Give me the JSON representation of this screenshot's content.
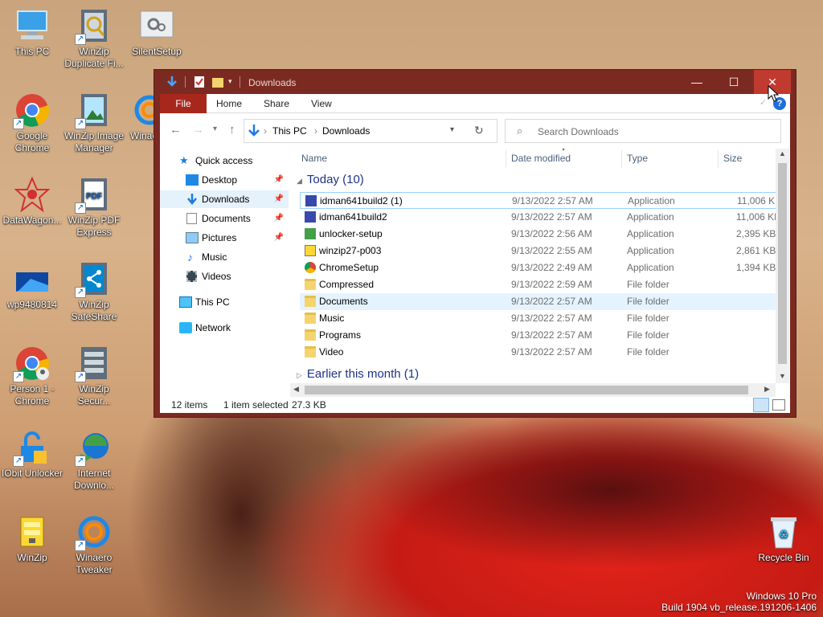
{
  "desktop": {
    "icons": [
      {
        "label": "This PC"
      },
      {
        "label": "WinZip Duplicate Fi..."
      },
      {
        "label": "SilentSetup"
      },
      {
        "label": "Google Chrome"
      },
      {
        "label": "WinZip Image Manager"
      },
      {
        "label": "Winae"
      },
      {
        "label": "DataWagon..."
      },
      {
        "label": "WinZip PDF Express"
      },
      {
        "label": "wp9480814"
      },
      {
        "label": "WinZip SafeShare"
      },
      {
        "label": "Person 1 - Chrome"
      },
      {
        "label": "WinZip Secur..."
      },
      {
        "label": "IObit Unlocker"
      },
      {
        "label": "Internet Downlo..."
      },
      {
        "label": "WinZip"
      },
      {
        "label": "Winaero Tweaker"
      },
      {
        "label": "Recycle Bin"
      }
    ],
    "watermark_line1": "Windows 10 Pro",
    "watermark_line2": "Build 1904 vb_release.191206-1406"
  },
  "window": {
    "title": "Downloads",
    "minimize_glyph": "—",
    "maximize_glyph": "☐",
    "close_glyph": "✕",
    "ribbon_tabs": [
      "File",
      "Home",
      "Share",
      "View"
    ],
    "help_glyph": "?",
    "address": {
      "crumb1": "This PC",
      "separator": "›",
      "crumb2": "Downloads"
    },
    "search_placeholder": "Search Downloads",
    "nav": {
      "quick_access": "Quick access",
      "desktop": "Desktop",
      "downloads": "Downloads",
      "documents": "Documents",
      "pictures": "Pictures",
      "music": "Music",
      "videos": "Videos",
      "this_pc": "This PC",
      "network": "Network"
    },
    "columns": {
      "name": "Name",
      "date": "Date modified",
      "type": "Type",
      "size": "Size"
    },
    "group_today": "Today (10)",
    "group_earlier": "Earlier this month (1)",
    "files": [
      {
        "name": "idman641build2 (1)",
        "date": "9/13/2022 2:57 AM",
        "type": "Application",
        "size": "11,006 KB"
      },
      {
        "name": "idman641build2",
        "date": "9/13/2022 2:57 AM",
        "type": "Application",
        "size": "11,006 KB"
      },
      {
        "name": "unlocker-setup",
        "date": "9/13/2022 2:56 AM",
        "type": "Application",
        "size": "2,395 KB"
      },
      {
        "name": "winzip27-p003",
        "date": "9/13/2022 2:55 AM",
        "type": "Application",
        "size": "2,861 KB"
      },
      {
        "name": "ChromeSetup",
        "date": "9/13/2022 2:49 AM",
        "type": "Application",
        "size": "1,394 KB"
      },
      {
        "name": "Compressed",
        "date": "9/13/2022 2:59 AM",
        "type": "File folder",
        "size": ""
      },
      {
        "name": "Documents",
        "date": "9/13/2022 2:57 AM",
        "type": "File folder",
        "size": ""
      },
      {
        "name": "Music",
        "date": "9/13/2022 2:57 AM",
        "type": "File folder",
        "size": ""
      },
      {
        "name": "Programs",
        "date": "9/13/2022 2:57 AM",
        "type": "File folder",
        "size": ""
      },
      {
        "name": "Video",
        "date": "9/13/2022 2:57 AM",
        "type": "File folder",
        "size": ""
      }
    ],
    "status": {
      "items": "12 items",
      "selected": "1 item selected",
      "size": "27.3 KB"
    }
  }
}
